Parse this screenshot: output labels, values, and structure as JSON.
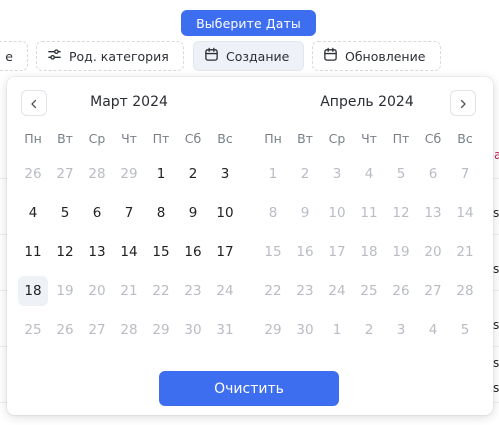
{
  "header": {
    "select_dates_label": "Выберите Даты"
  },
  "filters": {
    "left_partial_label": "е",
    "category_label": "Род. категория",
    "created_label": "Создание",
    "updated_label": "Обновление"
  },
  "background": {
    "right_edge_letters": [
      "s",
      "s",
      "s",
      "s",
      "s",
      "s"
    ]
  },
  "calendar": {
    "prev_icon": "chevron-left-icon",
    "next_icon": "chevron-right-icon",
    "weekdays": [
      "Пн",
      "Вт",
      "Ср",
      "Чт",
      "Пт",
      "Сб",
      "Вс"
    ],
    "months": [
      {
        "title": "Март 2024",
        "weeks": [
          [
            {
              "d": "26",
              "m": true
            },
            {
              "d": "27",
              "m": true
            },
            {
              "d": "28",
              "m": true
            },
            {
              "d": "29",
              "m": true
            },
            {
              "d": "1"
            },
            {
              "d": "2"
            },
            {
              "d": "3"
            }
          ],
          [
            {
              "d": "4"
            },
            {
              "d": "5"
            },
            {
              "d": "6"
            },
            {
              "d": "7"
            },
            {
              "d": "8"
            },
            {
              "d": "9"
            },
            {
              "d": "10"
            }
          ],
          [
            {
              "d": "11"
            },
            {
              "d": "12"
            },
            {
              "d": "13"
            },
            {
              "d": "14"
            },
            {
              "d": "15"
            },
            {
              "d": "16"
            },
            {
              "d": "17"
            }
          ],
          [
            {
              "d": "18",
              "today": true
            },
            {
              "d": "19",
              "m": true
            },
            {
              "d": "20",
              "m": true
            },
            {
              "d": "21",
              "m": true
            },
            {
              "d": "22",
              "m": true
            },
            {
              "d": "23",
              "m": true
            },
            {
              "d": "24",
              "m": true
            }
          ],
          [
            {
              "d": "25",
              "m": true
            },
            {
              "d": "26",
              "m": true
            },
            {
              "d": "27",
              "m": true
            },
            {
              "d": "28",
              "m": true
            },
            {
              "d": "29",
              "m": true
            },
            {
              "d": "30",
              "m": true
            },
            {
              "d": "31",
              "m": true
            }
          ]
        ]
      },
      {
        "title": "Апрель 2024",
        "weeks": [
          [
            {
              "d": "1",
              "m": true
            },
            {
              "d": "2",
              "m": true
            },
            {
              "d": "3",
              "m": true
            },
            {
              "d": "4",
              "m": true
            },
            {
              "d": "5",
              "m": true
            },
            {
              "d": "6",
              "m": true
            },
            {
              "d": "7",
              "m": true
            }
          ],
          [
            {
              "d": "8",
              "m": true
            },
            {
              "d": "9",
              "m": true
            },
            {
              "d": "10",
              "m": true
            },
            {
              "d": "11",
              "m": true
            },
            {
              "d": "12",
              "m": true
            },
            {
              "d": "13",
              "m": true
            },
            {
              "d": "14",
              "m": true
            }
          ],
          [
            {
              "d": "15",
              "m": true
            },
            {
              "d": "16",
              "m": true
            },
            {
              "d": "17",
              "m": true
            },
            {
              "d": "18",
              "m": true
            },
            {
              "d": "19",
              "m": true
            },
            {
              "d": "20",
              "m": true
            },
            {
              "d": "21",
              "m": true
            }
          ],
          [
            {
              "d": "22",
              "m": true
            },
            {
              "d": "23",
              "m": true
            },
            {
              "d": "24",
              "m": true
            },
            {
              "d": "25",
              "m": true
            },
            {
              "d": "26",
              "m": true
            },
            {
              "d": "27",
              "m": true
            },
            {
              "d": "28",
              "m": true
            }
          ],
          [
            {
              "d": "29",
              "m": true
            },
            {
              "d": "30",
              "m": true
            },
            {
              "d": "1",
              "m": true
            },
            {
              "d": "2",
              "m": true
            },
            {
              "d": "3",
              "m": true
            },
            {
              "d": "4",
              "m": true
            },
            {
              "d": "5",
              "m": true
            }
          ]
        ]
      }
    ],
    "clear_label": "Очистить"
  },
  "colors": {
    "accent": "#3d6ef0",
    "muted_day": "#b8bcc4",
    "today_bg": "#eef1f6"
  }
}
